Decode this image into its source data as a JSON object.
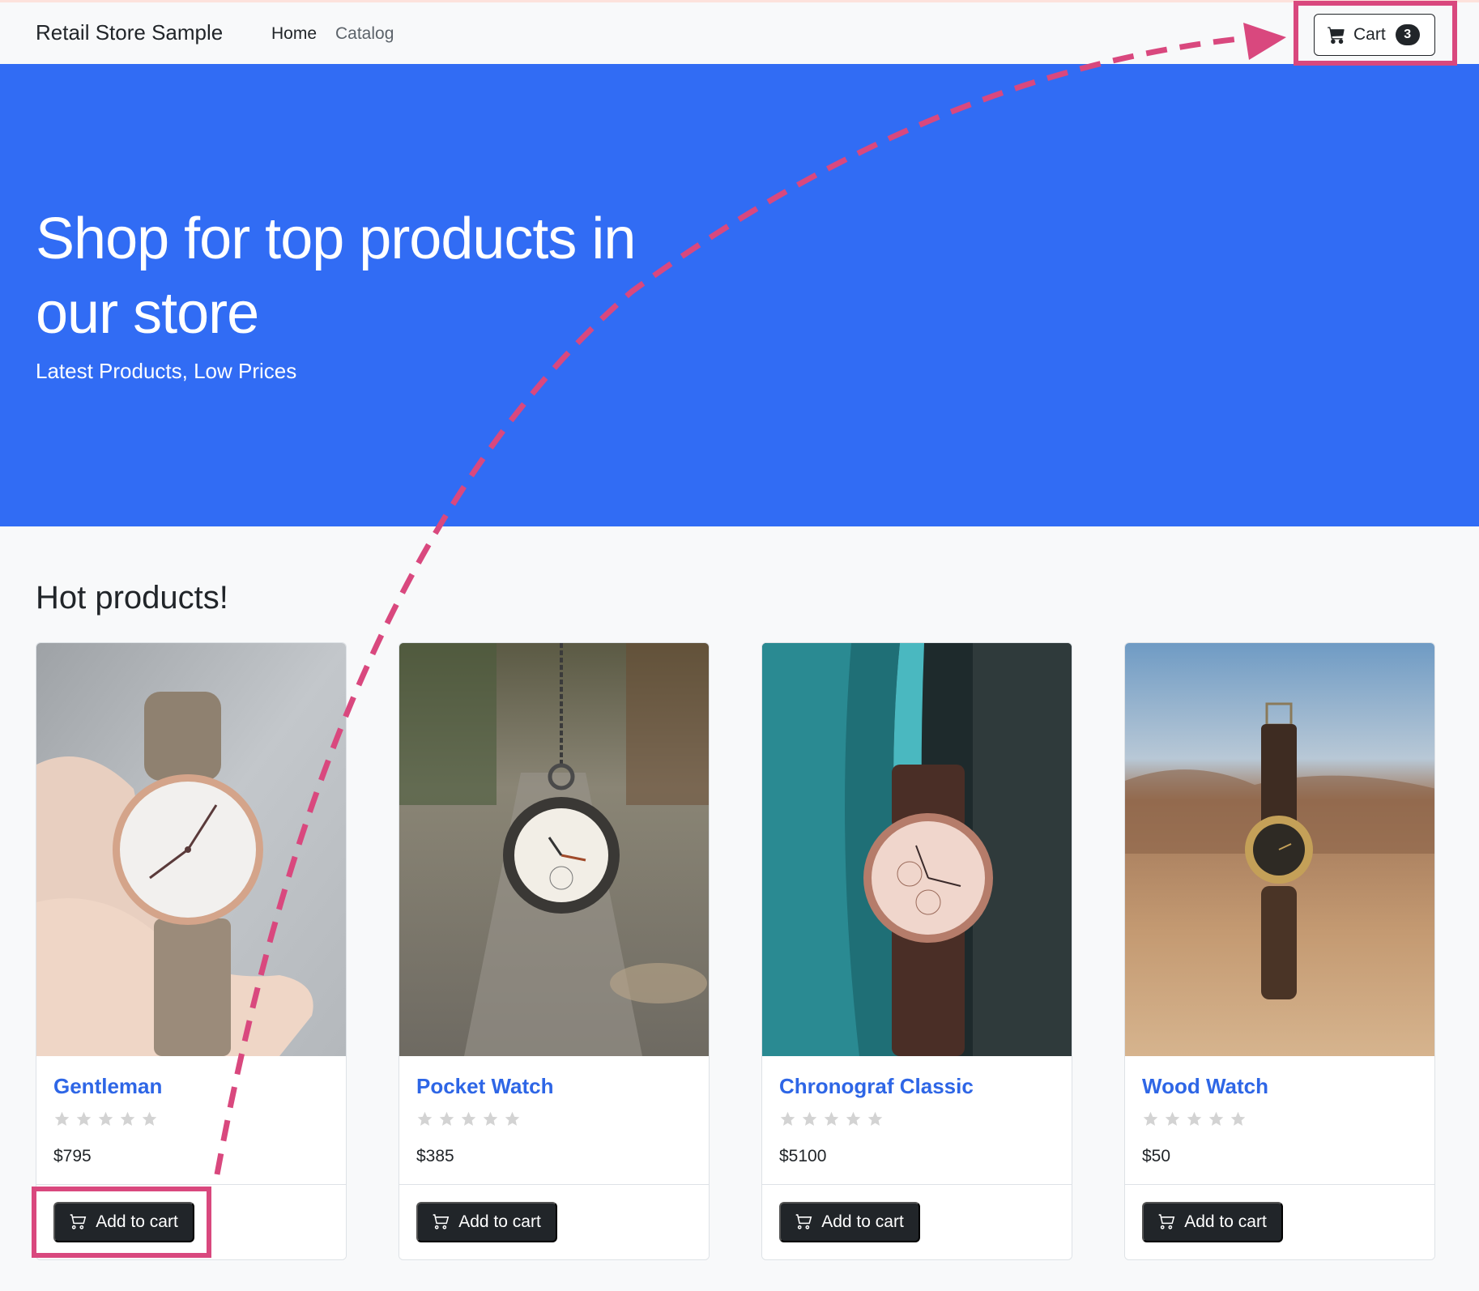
{
  "navbar": {
    "brand": "Retail Store Sample",
    "links": [
      {
        "label": "Home"
      },
      {
        "label": "Catalog"
      }
    ],
    "cart": {
      "label": "Cart",
      "count": "3"
    }
  },
  "hero": {
    "title": "Shop for top products in our store",
    "subtitle": "Latest Products, Low Prices"
  },
  "section": {
    "title": "Hot products!"
  },
  "products": [
    {
      "name": "Gentleman",
      "price": "$795",
      "rating": 0,
      "button": "Add to cart",
      "image": "wristwatch-held-in-hand-photo"
    },
    {
      "name": "Pocket Watch",
      "price": "$385",
      "rating": 0,
      "button": "Add to cart",
      "image": "hanging-pocket-watch-photo"
    },
    {
      "name": "Chronograf Classic",
      "price": "$5100",
      "rating": 0,
      "button": "Add to cart",
      "image": "chronograph-watch-teal-fabric-photo"
    },
    {
      "name": "Wood Watch",
      "price": "$50",
      "rating": 0,
      "button": "Add to cart",
      "image": "wood-watch-desert-photo"
    }
  ],
  "colors": {
    "primary": "#316cf4",
    "link": "#2e66e6",
    "dark": "#212529",
    "annotation": "#d9487e"
  }
}
